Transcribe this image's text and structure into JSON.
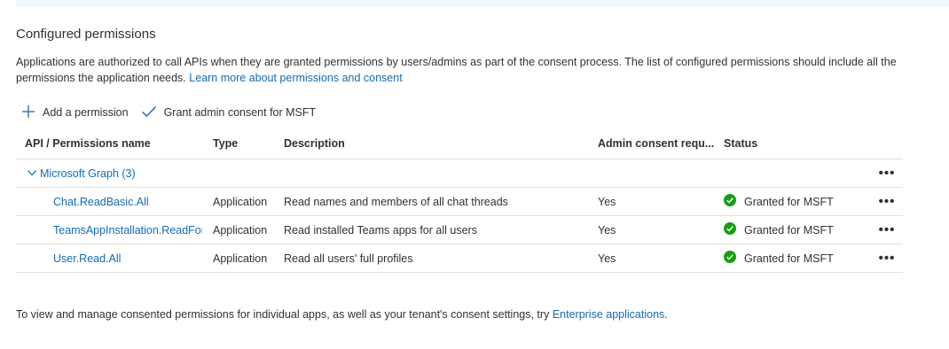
{
  "section": {
    "title": "Configured permissions",
    "intro_text": "Applications are authorized to call APIs when they are granted permissions by users/admins as part of the consent process. The list of configured permissions should include all the permissions the application needs.",
    "intro_link": "Learn more about permissions and consent"
  },
  "toolbar": {
    "add_label": "Add a permission",
    "grant_label": "Grant admin consent for MSFT"
  },
  "table": {
    "headers": {
      "api": "API / Permissions name",
      "type": "Type",
      "description": "Description",
      "admin": "Admin consent requ...",
      "status": "Status"
    },
    "group": {
      "label": "Microsoft Graph (3)",
      "more": "•••"
    },
    "rows": [
      {
        "name": "Chat.ReadBasic.All",
        "type": "Application",
        "description": "Read names and members of all chat threads",
        "admin": "Yes",
        "status": "Granted for MSFT",
        "more": "•••"
      },
      {
        "name": "TeamsAppInstallation.ReadForUser.All",
        "type": "Application",
        "description": "Read installed Teams apps for all users",
        "admin": "Yes",
        "status": "Granted for MSFT",
        "more": "•••"
      },
      {
        "name": "User.Read.All",
        "type": "Application",
        "description": "Read all users' full profiles",
        "admin": "Yes",
        "status": "Granted for MSFT",
        "more": "•••"
      }
    ]
  },
  "footer": {
    "text": "To view and manage consented permissions for individual apps, as well as your tenant's consent settings, try",
    "link": "Enterprise applications",
    "end": "."
  },
  "colors": {
    "link": "#0f6cbd",
    "success": "#13a10e",
    "border": "#e1dfdd"
  },
  "icons": [
    "plus-icon",
    "checkmark-icon",
    "chevron-down-icon",
    "success-check-icon",
    "more-icon"
  ]
}
